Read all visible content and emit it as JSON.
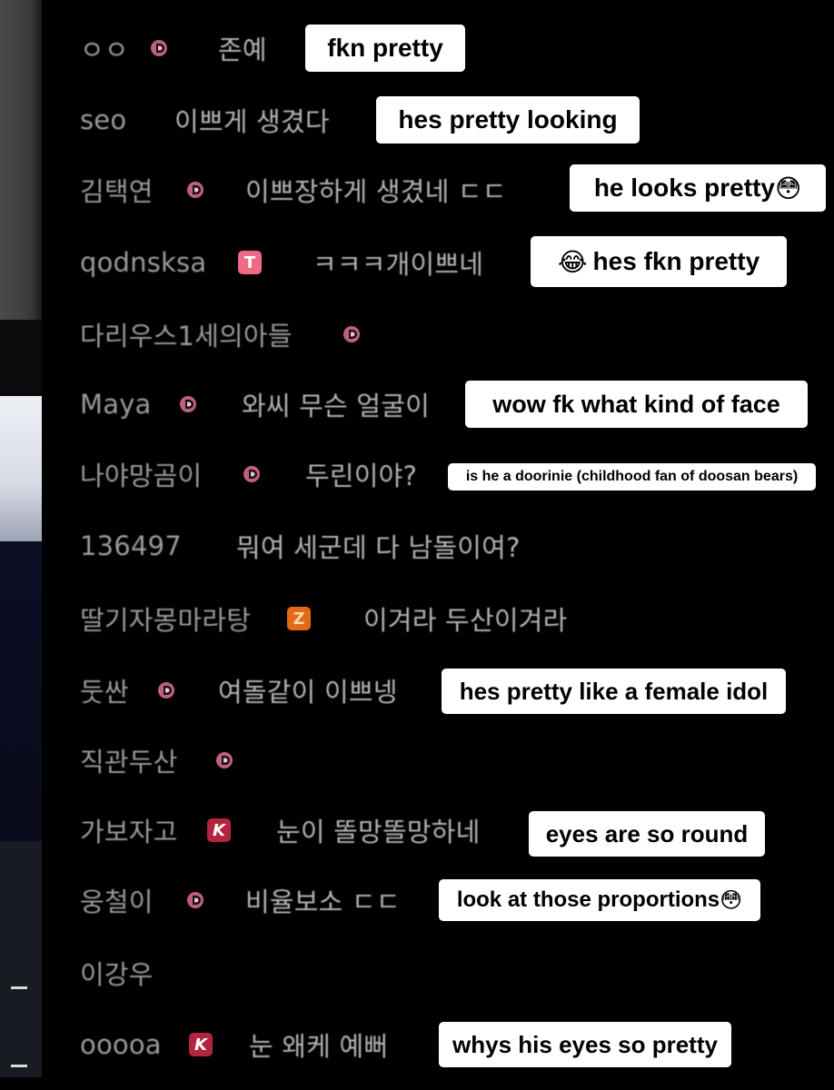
{
  "chat": {
    "rows": [
      {
        "nick": "ㅇㅇ",
        "badge": "d",
        "message": "존예",
        "caption": "fkn pretty"
      },
      {
        "nick": "seo",
        "badge": "",
        "message": "이쁘게 생겼다",
        "caption": "hes pretty looking"
      },
      {
        "nick": "김택연",
        "badge": "d",
        "message": "이쁘장하게 생겼네 ㄷㄷ",
        "caption": "he looks pretty",
        "caption_emoji": "😳"
      },
      {
        "nick": "qodnsksa",
        "badge": "t",
        "badge_glyph": "T",
        "message": "ㅋㅋㅋ개이쁘네",
        "caption": "hes fkn pretty",
        "caption_emoji_before": "😂"
      },
      {
        "nick": "다리우스1세의아들",
        "badge": "d",
        "message": "",
        "caption": ""
      },
      {
        "nick": "Maya",
        "badge": "d",
        "message": "와씨 무슨 얼굴이",
        "caption": "wow fk what kind of face"
      },
      {
        "nick": "나야망곰이",
        "badge": "d",
        "message": "두린이야?",
        "caption": "is he a doorinie (childhood fan of doosan bears)"
      },
      {
        "nick": "136497",
        "badge": "",
        "message": "뭐여 세군데 다 남돌이여?",
        "caption": ""
      },
      {
        "nick": "딸기자몽마라탕",
        "badge": "z",
        "badge_glyph": "Z",
        "message": "이겨라 두산이겨라",
        "caption": ""
      },
      {
        "nick": "둣싼",
        "badge": "d",
        "message": "여돌같이 이쁘넹",
        "caption": "hes pretty like a female idol"
      },
      {
        "nick": "직관두산",
        "badge": "d",
        "message": "",
        "caption": ""
      },
      {
        "nick": "가보자고",
        "badge": "k",
        "badge_glyph": "K",
        "message": "눈이 똘망똘망하네",
        "caption": "eyes are so round"
      },
      {
        "nick": "웅철이",
        "badge": "d",
        "message": "비율보소 ㄷㄷ",
        "caption": "look at those proportions",
        "caption_emoji": "😳"
      },
      {
        "nick": "이강우",
        "badge": "",
        "message": "",
        "caption": ""
      },
      {
        "nick": "ooooa",
        "badge": "k",
        "badge_glyph": "K",
        "message": "눈 왜케 예뻐",
        "caption": "whys his eyes so pretty"
      }
    ]
  },
  "colors": {
    "background": "#000000",
    "chat_text": "#9a9a9a",
    "caption_bg": "#ffffff",
    "badge_d": "#f06a86"
  },
  "icons": {
    "d": "doosan-d-badge-icon",
    "t": "tving-t-badge-icon",
    "z": "orange-z-badge-icon",
    "k": "red-k-badge-icon"
  }
}
